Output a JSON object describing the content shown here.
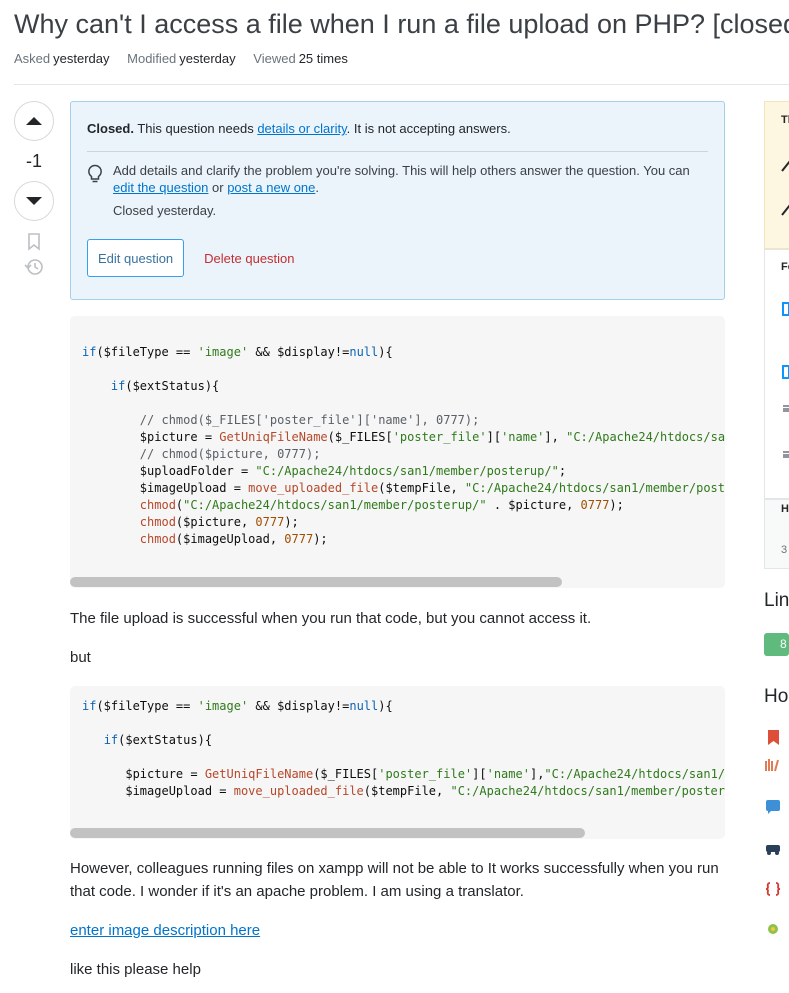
{
  "question": {
    "title": "Why can't I access a file when I run a file upload on PHP? [closed]",
    "meta": {
      "asked_label": "Asked",
      "asked_value": "yesterday",
      "modified_label": "Modified",
      "modified_value": "yesterday",
      "viewed_label": "Viewed",
      "viewed_value": "25 times"
    },
    "vote_count": "-1"
  },
  "notice": {
    "closed_label": "Closed.",
    "closed_text1": " This question needs ",
    "closed_link": "details or clarity",
    "closed_text2": ". It is not accepting answers.",
    "hint_text1": "Add details and clarify the problem you're solving. This will help others answer the question. You can ",
    "hint_link1": "edit the question",
    "hint_or": " or ",
    "hint_link2": "post a new one",
    "hint_end": ".",
    "closed_time": "Closed yesterday.",
    "edit_button": "Edit question",
    "delete_button": "Delete question"
  },
  "body": {
    "para1": "The file upload is successful when you run that code, but you cannot access it.",
    "para2": "but",
    "para3": "However, colleagues running files on xampp will not be able to It works successfully when you run that code. I wonder if it's an apache problem. I am using a translator.",
    "image_link": "enter image description here",
    "para4": "like this please help"
  },
  "sidebar": {
    "box1_title": "Th",
    "box2_title": "Fe",
    "box3_title": "H",
    "box3_value": "3",
    "linked_heading": "Lin",
    "linked_count": "8",
    "hot_heading": "Ho"
  },
  "colors": {
    "link": "#0074cc",
    "notice_bg": "#ebf4fb",
    "delete": "#c22e32",
    "badge_green": "#5eba7d"
  }
}
